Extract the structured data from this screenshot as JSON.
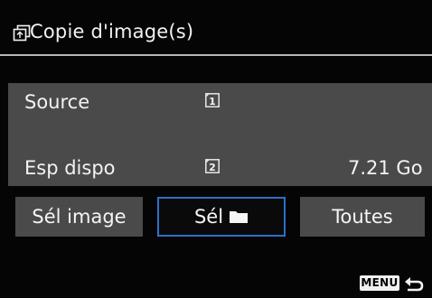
{
  "header": {
    "title": "Copie d'image(s)",
    "icon": "copy-image-icon"
  },
  "info": {
    "source_label": "Source",
    "source_card_number": "1",
    "free_space_label": "Esp dispo",
    "free_space_card_number": "2",
    "free_space_value": "7.21 Go"
  },
  "tabs": {
    "items": [
      {
        "label": "Sél image"
      },
      {
        "label": "Sél",
        "icon": "folder-icon",
        "selected": true
      },
      {
        "label": "Toutes"
      }
    ]
  },
  "footer": {
    "menu_label": "MENU",
    "return_icon": "return-arrow-icon"
  },
  "colors": {
    "background": "#050505",
    "panel": "#4a4a4a",
    "selection_border": "#2f6fc8",
    "text": "#f2f2f2"
  }
}
